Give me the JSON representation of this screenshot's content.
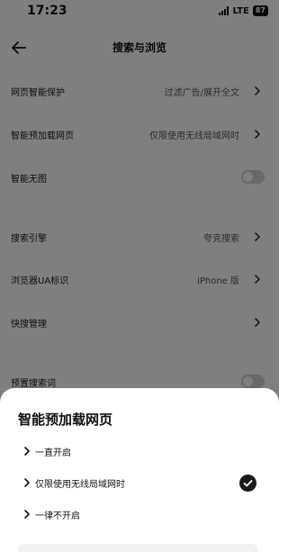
{
  "status_bar": {
    "time": "17:23",
    "network": "LTE",
    "battery": "87"
  },
  "nav": {
    "title": "搜索与浏览",
    "back_icon": "arrow-left-icon"
  },
  "settings": {
    "web_protection": {
      "label": "网页智能保护",
      "value": "过滤广告/展开全文"
    },
    "smart_preload": {
      "label": "智能预加载网页",
      "value": "仅限使用无线局域网时"
    },
    "no_image": {
      "label": "智能无图",
      "toggle": "off"
    },
    "search_engine": {
      "label": "搜索引擎",
      "value": "夸克搜索"
    },
    "user_agent": {
      "label": "浏览器UA标识",
      "value": "iPhone 版"
    },
    "quick_search": {
      "label": "快搜管理"
    },
    "preset_search_words": {
      "label": "预置搜索词",
      "toggle": "off"
    }
  },
  "sheet": {
    "title": "智能预加载网页",
    "options": [
      {
        "label": "一直开启",
        "selected": false
      },
      {
        "label": "仅限使用无线局域网时",
        "selected": true
      },
      {
        "label": "一律不开启",
        "selected": false
      }
    ],
    "check_icon": "check-circle-icon"
  },
  "colors": {
    "overlay": "rgba(0,0,0,0.5)",
    "sheet_background": "#ffffff",
    "check_fill": "#1a1a1a",
    "toggle_off": "#d0d0d0"
  }
}
